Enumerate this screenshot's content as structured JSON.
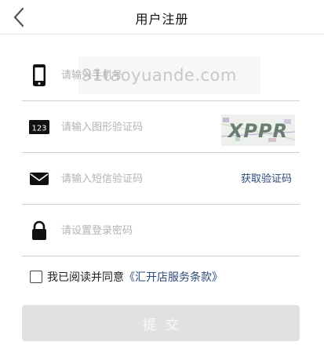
{
  "nav": {
    "title": "用户注册",
    "back_icon": "chevron-left-icon"
  },
  "watermark": {
    "text": "91taoyuande.com"
  },
  "form": {
    "phone": {
      "placeholder": "请输入手机号",
      "icon": "phone-icon"
    },
    "image_code": {
      "placeholder": "请输入图形验证码",
      "icon": "123-icon",
      "captcha_text": "XPPR"
    },
    "sms_code": {
      "placeholder": "请输入短信验证码",
      "icon": "mail-icon",
      "get_code_label": "获取验证码"
    },
    "password": {
      "placeholder": "请设置登录密码",
      "icon": "lock-icon"
    }
  },
  "agreement": {
    "prefix": "我已阅读并同意",
    "link": "《汇开店服务条款》",
    "checked": false
  },
  "submit": {
    "label": "提交"
  },
  "colors": {
    "link": "#2b4a78",
    "button_disabled": "#e1e1e1",
    "divider": "#cfcfcf"
  }
}
